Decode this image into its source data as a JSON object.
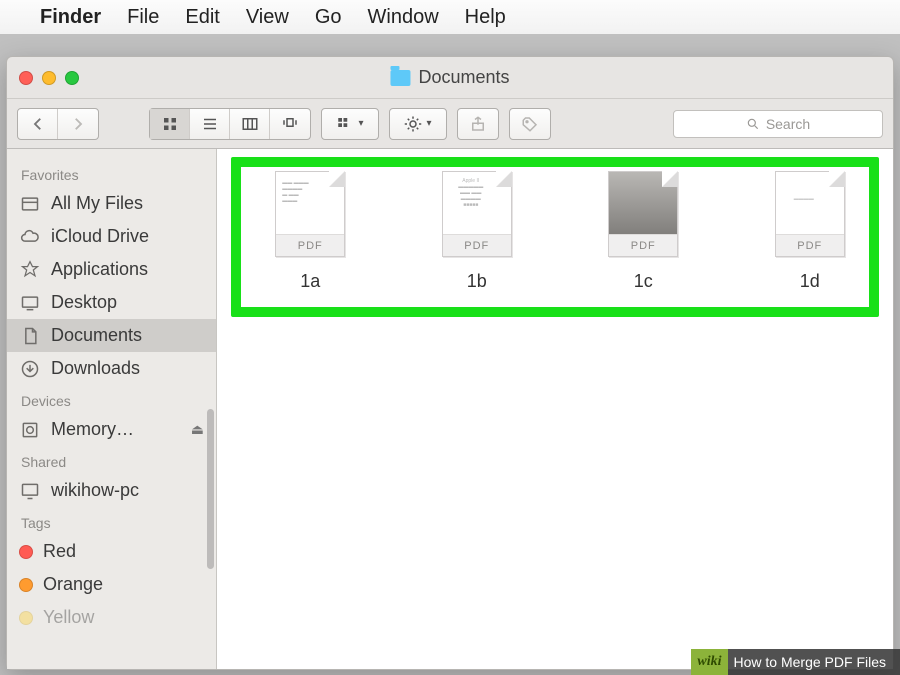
{
  "menubar": {
    "app": "Finder",
    "items": [
      "File",
      "Edit",
      "View",
      "Go",
      "Window",
      "Help"
    ]
  },
  "window": {
    "title": "Documents"
  },
  "search": {
    "placeholder": "Search"
  },
  "sidebar": {
    "favorites_header": "Favorites",
    "favorites": [
      {
        "label": "All My Files"
      },
      {
        "label": "iCloud Drive"
      },
      {
        "label": "Applications"
      },
      {
        "label": "Desktop"
      },
      {
        "label": "Documents",
        "selected": true
      },
      {
        "label": "Downloads"
      }
    ],
    "devices_header": "Devices",
    "devices": [
      {
        "label": "Memory…",
        "ejectable": true
      }
    ],
    "shared_header": "Shared",
    "shared": [
      {
        "label": "wikihow-pc"
      }
    ],
    "tags_header": "Tags",
    "tags": [
      {
        "label": "Red",
        "color": "#ff5b53"
      },
      {
        "label": "Orange",
        "color": "#ff9b2f"
      },
      {
        "label": "Yellow",
        "color": "#ffd23a"
      }
    ]
  },
  "files": [
    {
      "name": "1a",
      "badge": "PDF"
    },
    {
      "name": "1b",
      "badge": "PDF"
    },
    {
      "name": "1c",
      "badge": "PDF"
    },
    {
      "name": "1d",
      "badge": "PDF"
    }
  ],
  "overlay": {
    "brand": "wiki",
    "caption": "How to Merge PDF Files"
  }
}
